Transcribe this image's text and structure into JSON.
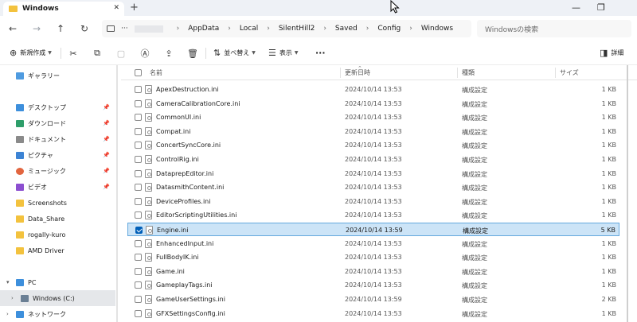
{
  "window": {
    "tab_title": "Windows",
    "close_tab": "✕",
    "new_tab": "+",
    "minimize": "—",
    "maximize": "❐"
  },
  "nav": {
    "back": "←",
    "forward": "→",
    "up": "↑",
    "refresh": "↻"
  },
  "address": {
    "overflow": "···",
    "crumbs": [
      "AppData",
      "Local",
      "SilentHill2",
      "Saved",
      "Config",
      "Windows"
    ],
    "separator": "›"
  },
  "search": {
    "placeholder": "Windowsの検索"
  },
  "toolbar": {
    "new_label": "新規作成",
    "sort_label": "並べ替え",
    "view_label": "表示",
    "more_label": "···",
    "details_label": "詳細"
  },
  "sidebar": {
    "items": [
      {
        "label": "ギャラリー",
        "icon_color": "#4f9be0"
      },
      {
        "label": "デスクトップ",
        "icon_color": "#3d8fdc"
      },
      {
        "label": "ダウンロード",
        "icon_color": "#2e9e6a"
      },
      {
        "label": "ドキュメント",
        "icon_color": "#8a8a8a"
      },
      {
        "label": "ピクチャ",
        "icon_color": "#3c83d4"
      },
      {
        "label": "ミュージック",
        "icon_color": "#e2653f"
      },
      {
        "label": "ビデオ",
        "icon_color": "#8c4fd0"
      },
      {
        "label": "Screenshots",
        "icon_color": "#f3c23e"
      },
      {
        "label": "Data_Share",
        "icon_color": "#f3c23e"
      },
      {
        "label": "rogally-kuro",
        "icon_color": "#f3c23e"
      },
      {
        "label": "AMD Driver",
        "icon_color": "#f3c23e"
      },
      {
        "label": "PC",
        "icon_color": "#3d8fdc"
      },
      {
        "label": "Windows (C:)",
        "icon_color": "#6a7f94"
      },
      {
        "label": "ネットワーク",
        "icon_color": "#3d8fdc"
      }
    ]
  },
  "columns": {
    "name": "名前",
    "modified": "更新日時",
    "type": "種類",
    "size": "サイズ"
  },
  "files": [
    {
      "name": "ApexDestruction.ini",
      "modified": "2024/10/14 13:53",
      "type": "構成設定",
      "size": "1 KB"
    },
    {
      "name": "CameraCalibrationCore.ini",
      "modified": "2024/10/14 13:53",
      "type": "構成設定",
      "size": "1 KB"
    },
    {
      "name": "CommonUI.ini",
      "modified": "2024/10/14 13:53",
      "type": "構成設定",
      "size": "1 KB"
    },
    {
      "name": "Compat.ini",
      "modified": "2024/10/14 13:53",
      "type": "構成設定",
      "size": "1 KB"
    },
    {
      "name": "ConcertSyncCore.ini",
      "modified": "2024/10/14 13:53",
      "type": "構成設定",
      "size": "1 KB"
    },
    {
      "name": "ControlRig.ini",
      "modified": "2024/10/14 13:53",
      "type": "構成設定",
      "size": "1 KB"
    },
    {
      "name": "DataprepEditor.ini",
      "modified": "2024/10/14 13:53",
      "type": "構成設定",
      "size": "1 KB"
    },
    {
      "name": "DatasmithContent.ini",
      "modified": "2024/10/14 13:53",
      "type": "構成設定",
      "size": "1 KB"
    },
    {
      "name": "DeviceProfiles.ini",
      "modified": "2024/10/14 13:53",
      "type": "構成設定",
      "size": "1 KB"
    },
    {
      "name": "EditorScriptingUtilities.ini",
      "modified": "2024/10/14 13:53",
      "type": "構成設定",
      "size": "1 KB"
    },
    {
      "name": "Engine.ini",
      "modified": "2024/10/14 13:59",
      "type": "構成設定",
      "size": "5 KB",
      "selected": true
    },
    {
      "name": "EnhancedInput.ini",
      "modified": "2024/10/14 13:53",
      "type": "構成設定",
      "size": "1 KB"
    },
    {
      "name": "FullBodyIK.ini",
      "modified": "2024/10/14 13:53",
      "type": "構成設定",
      "size": "1 KB"
    },
    {
      "name": "Game.ini",
      "modified": "2024/10/14 13:53",
      "type": "構成設定",
      "size": "1 KB"
    },
    {
      "name": "GameplayTags.ini",
      "modified": "2024/10/14 13:53",
      "type": "構成設定",
      "size": "1 KB"
    },
    {
      "name": "GameUserSettings.ini",
      "modified": "2024/10/14 13:59",
      "type": "構成設定",
      "size": "2 KB"
    },
    {
      "name": "GFXSettingsConfig.ini",
      "modified": "2024/10/14 13:53",
      "type": "構成設定",
      "size": "1 KB"
    }
  ]
}
